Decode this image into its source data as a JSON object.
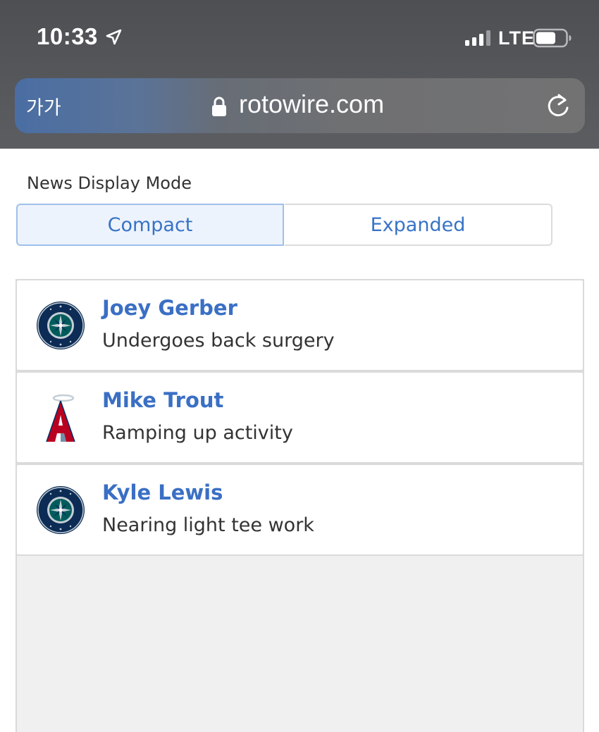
{
  "status_bar": {
    "time": "10:33",
    "network": "LTE",
    "icons": [
      "location-arrow-icon",
      "signal-bars-icon",
      "battery-icon"
    ]
  },
  "browser": {
    "text_size_button": "가가",
    "url": "rotowire.com",
    "icons": [
      "lock-icon",
      "reload-icon"
    ]
  },
  "news_mode": {
    "label": "News Display Mode",
    "options": [
      "Compact",
      "Expanded"
    ],
    "selected": "Compact"
  },
  "news_items": [
    {
      "team_logo": "seattle-mariners-logo",
      "player": "Joey Gerber",
      "headline": "Undergoes back surgery"
    },
    {
      "team_logo": "los-angeles-angels-logo",
      "player": "Mike Trout",
      "headline": "Ramping up activity"
    },
    {
      "team_logo": "seattle-mariners-logo",
      "player": "Kyle Lewis",
      "headline": "Nearing light tee work"
    }
  ],
  "colors": {
    "link_blue": "#3a6fc4",
    "segment_selected_bg": "#edf3fc",
    "mariners_navy": "#0c2c56",
    "mariners_teal": "#005c5c",
    "angels_red": "#ba0021"
  }
}
